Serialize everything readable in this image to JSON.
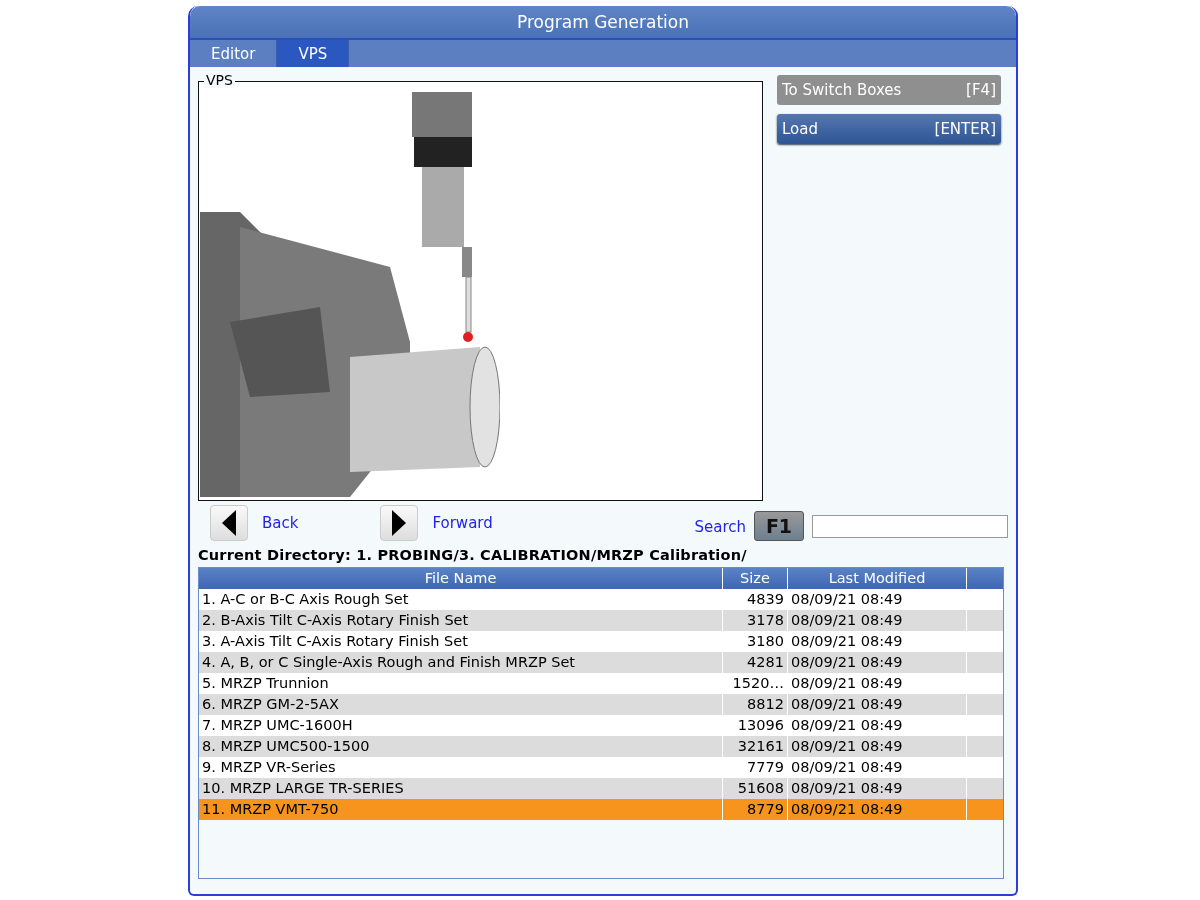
{
  "window": {
    "title": "Program Generation"
  },
  "tabs": [
    {
      "label": "Editor",
      "selected": false
    },
    {
      "label": "VPS",
      "selected": true
    }
  ],
  "preview": {
    "legend": "VPS"
  },
  "side_buttons": [
    {
      "label": "To Switch Boxes",
      "key": "[F4]",
      "disabled": true
    },
    {
      "label": "Load",
      "key": "[ENTER]",
      "disabled": false
    }
  ],
  "nav": {
    "back": "Back",
    "forward": "Forward",
    "search_label": "Search",
    "search_key": "F1"
  },
  "current_directory": "Current Directory: 1. PROBING/3. CALIBRATION/MRZP Calibration/",
  "table": {
    "columns": [
      "File Name",
      "Size",
      "Last Modified"
    ],
    "rows": [
      {
        "name": "1. A-C or B-C Axis Rough Set",
        "size": "4839",
        "modified": "08/09/21 08:49",
        "selected": false
      },
      {
        "name": "2. B-Axis Tilt C-Axis Rotary Finish Set",
        "size": "3178",
        "modified": "08/09/21 08:49",
        "selected": false
      },
      {
        "name": "3. A-Axis Tilt C-Axis Rotary Finish Set",
        "size": "3180",
        "modified": "08/09/21 08:49",
        "selected": false
      },
      {
        "name": "4. A, B, or C Single-Axis Rough and Finish MRZP Set",
        "size": "4281",
        "modified": "08/09/21 08:49",
        "selected": false
      },
      {
        "name": "5. MRZP Trunnion",
        "size": "1520…",
        "modified": "08/09/21 08:49",
        "selected": false
      },
      {
        "name": "6. MRZP GM-2-5AX",
        "size": "8812",
        "modified": "08/09/21 08:49",
        "selected": false
      },
      {
        "name": "7. MRZP UMC-1600H",
        "size": "13096",
        "modified": "08/09/21 08:49",
        "selected": false
      },
      {
        "name": "8. MRZP UMC500-1500",
        "size": "32161",
        "modified": "08/09/21 08:49",
        "selected": false
      },
      {
        "name": "9. MRZP VR-Series",
        "size": "7779",
        "modified": "08/09/21 08:49",
        "selected": false
      },
      {
        "name": "10. MRZP LARGE TR-SERIES",
        "size": "51608",
        "modified": "08/09/21 08:49",
        "selected": false
      },
      {
        "name": "11. MRZP VMT-750",
        "size": "8779",
        "modified": "08/09/21 08:49",
        "selected": true
      }
    ]
  }
}
